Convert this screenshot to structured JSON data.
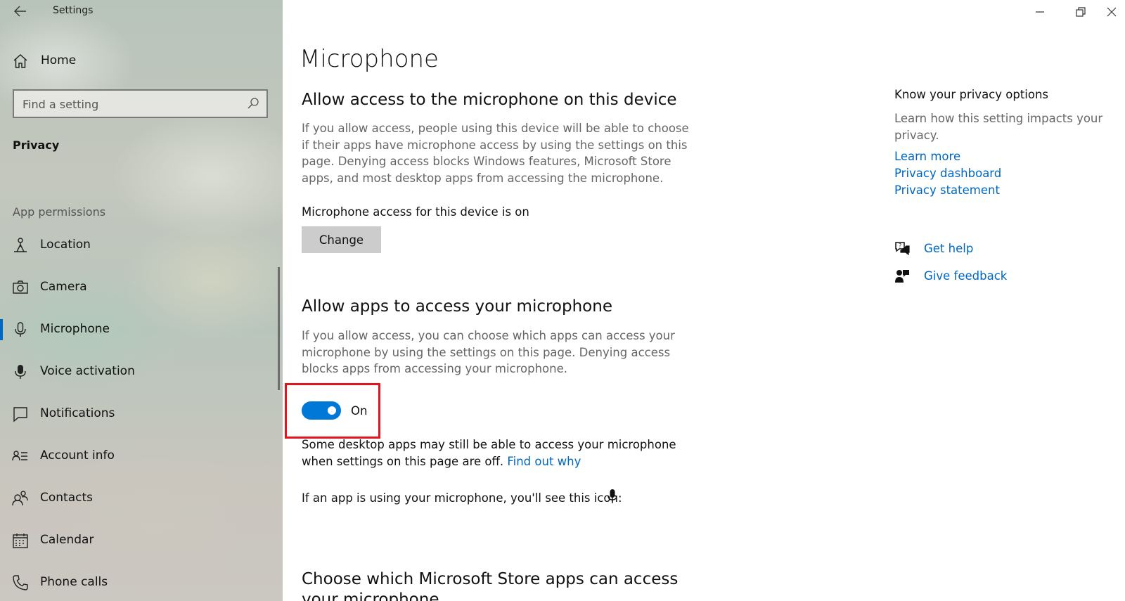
{
  "window": {
    "app_title": "Settings"
  },
  "sidebar": {
    "home_label": "Home",
    "search_placeholder": "Find a setting",
    "section_title": "Privacy",
    "group_title": "App permissions",
    "items": [
      {
        "label": "Location",
        "icon": "location-icon"
      },
      {
        "label": "Camera",
        "icon": "camera-icon"
      },
      {
        "label": "Microphone",
        "icon": "microphone-icon",
        "active": true
      },
      {
        "label": "Voice activation",
        "icon": "voice-activation-icon"
      },
      {
        "label": "Notifications",
        "icon": "notifications-icon"
      },
      {
        "label": "Account info",
        "icon": "account-info-icon"
      },
      {
        "label": "Contacts",
        "icon": "contacts-icon"
      },
      {
        "label": "Calendar",
        "icon": "calendar-icon"
      },
      {
        "label": "Phone calls",
        "icon": "phone-icon"
      }
    ]
  },
  "main": {
    "page_title": "Microphone",
    "device_section": {
      "heading": "Allow access to the microphone on this device",
      "description": "If you allow access, people using this device will be able to choose if their apps have microphone access by using the settings on this page. Denying access blocks Windows features, Microsoft Store apps, and most desktop apps from accessing the microphone.",
      "state_text": "Microphone access for this device is on",
      "change_button": "Change"
    },
    "apps_section": {
      "heading": "Allow apps to access your microphone",
      "description": "If you allow access, you can choose which apps can access your microphone by using the settings on this page. Denying access blocks apps from accessing your microphone.",
      "toggle_on": true,
      "toggle_label": "On",
      "note_text": "Some desktop apps may still be able to access your microphone when settings on this page are off.",
      "note_link": "Find out why",
      "icon_line": "If an app is using your microphone, you'll see this icon:"
    },
    "store_section": {
      "heading": "Choose which Microsoft Store apps can access your microphone"
    }
  },
  "right_panel": {
    "title": "Know your privacy options",
    "description": "Learn how this setting impacts your privacy.",
    "links": [
      "Learn more",
      "Privacy dashboard",
      "Privacy statement"
    ],
    "get_help": "Get help",
    "give_feedback": "Give feedback"
  },
  "colors": {
    "accent": "#0078d7",
    "link": "#0067c0",
    "highlight_box": "#e3141e"
  }
}
